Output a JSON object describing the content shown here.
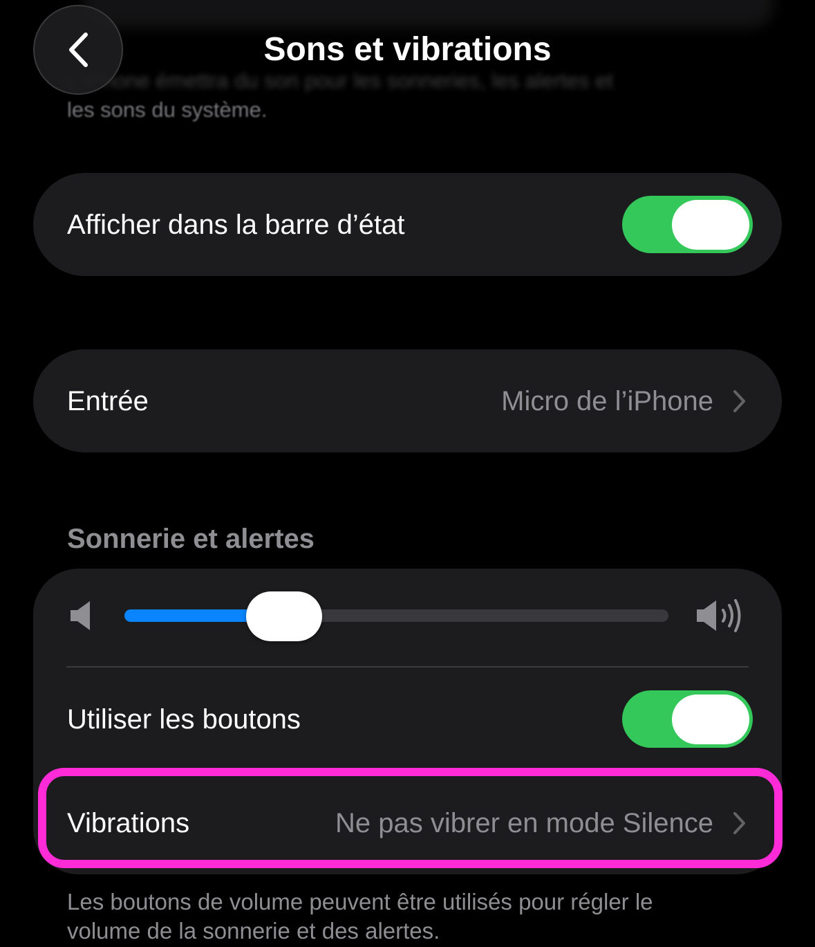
{
  "header": {
    "back_icon": "chevron-left-icon",
    "title": "Sons et vibrations"
  },
  "previous_section_footer": {
    "line1": "L'iPhone émettra du son pour les sonneries, les alertes et",
    "line2": "les sons du système."
  },
  "status_bar_row": {
    "label": "Afficher dans la barre d’état",
    "toggle_on": true
  },
  "input_row": {
    "label": "Entrée",
    "value": "Micro de l’iPhone"
  },
  "ringer_section": {
    "header": "Sonnerie et alertes",
    "volume_level": 0.26,
    "volume_low_icon": "speaker-low-icon",
    "volume_high_icon": "speaker-high-icon",
    "use_buttons_label": "Utiliser les boutons",
    "use_buttons_on": true,
    "vibrations_label": "Vibrations",
    "vibrations_value": "Ne pas vibrer en mode Silence",
    "footer_line1": "Les boutons de volume peuvent être utilisés pour régler le",
    "footer_line2": "volume de la sonnerie et des alertes."
  },
  "colors": {
    "background": "#000000",
    "card": "#1c1c1e",
    "toggle_on": "#34c759",
    "slider_fill": "#0a84ff",
    "secondary_text": "#8e8e93",
    "highlight": "#ff2bd6"
  }
}
